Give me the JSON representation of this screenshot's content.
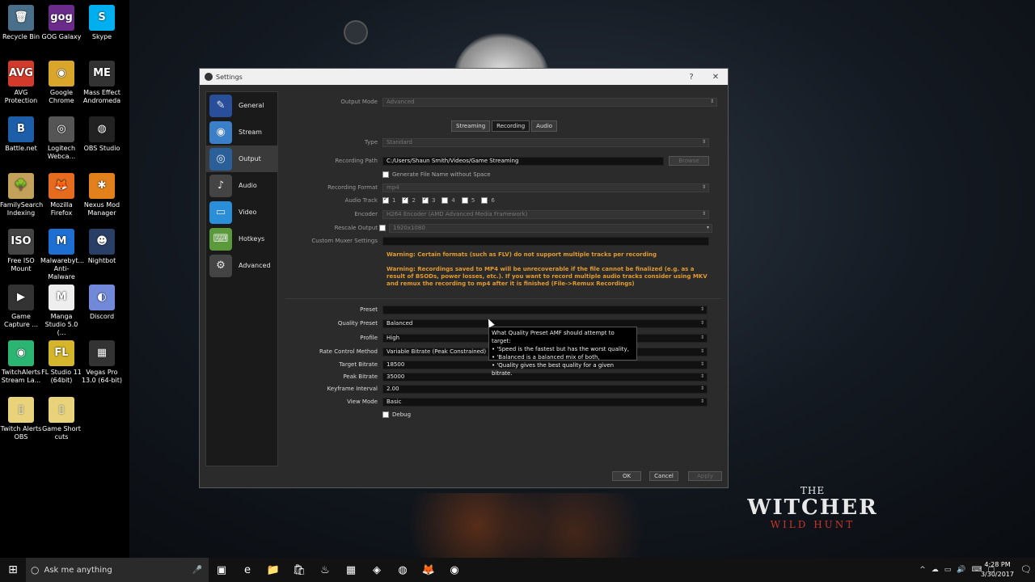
{
  "desktop": {
    "icons": [
      {
        "label": "Recycle Bin",
        "glyph": "🗑",
        "color": "#4a6f8a"
      },
      {
        "label": "GOG Galaxy",
        "glyph": "gog",
        "color": "#6a2b8a"
      },
      {
        "label": "Skype",
        "glyph": "S",
        "color": "#00aff0"
      },
      {
        "label": "AVG Protection",
        "glyph": "AVG",
        "color": "#d23b2b"
      },
      {
        "label": "Google Chrome",
        "glyph": "◉",
        "color": "#d9a52b"
      },
      {
        "label": "Mass Effect Andromeda",
        "glyph": "ME",
        "color": "#333333"
      },
      {
        "label": "Battle.net",
        "glyph": "B",
        "color": "#1c5fa8"
      },
      {
        "label": "Logitech Webca...",
        "glyph": "◎",
        "color": "#555555"
      },
      {
        "label": "OBS Studio",
        "glyph": "◍",
        "color": "#222222"
      },
      {
        "label": "FamilySearch Indexing",
        "glyph": "🌳",
        "color": "#c4a15a"
      },
      {
        "label": "Mozilla Firefox",
        "glyph": "🦊",
        "color": "#e66b1f"
      },
      {
        "label": "Nexus Mod Manager",
        "glyph": "✱",
        "color": "#e2811c"
      },
      {
        "label": "Free ISO Mount",
        "glyph": "ISO",
        "color": "#444444"
      },
      {
        "label": "Malwarebyt... Anti-Malware",
        "glyph": "M",
        "color": "#1d6fd1"
      },
      {
        "label": "Nightbot",
        "glyph": "☻",
        "color": "#2a3f66"
      },
      {
        "label": "Game Capture ...",
        "glyph": "▶",
        "color": "#333333"
      },
      {
        "label": "Manga Studio 5.0 (...",
        "glyph": "M",
        "color": "#eeeeee"
      },
      {
        "label": "Discord",
        "glyph": "◐",
        "color": "#7289da"
      },
      {
        "label": "TwitchAlerts Stream La...",
        "glyph": "◉",
        "color": "#2ab573"
      },
      {
        "label": "FL Studio 11 (64bit)",
        "glyph": "FL",
        "color": "#d4b52b"
      },
      {
        "label": "Vegas Pro 13.0 (64-bit)",
        "glyph": "▦",
        "color": "#333333"
      },
      {
        "label": "Twitch Alerts OBS",
        "glyph": "▯",
        "color": "#e8d37a"
      },
      {
        "label": "Game Short cuts",
        "glyph": "▯",
        "color": "#e8d37a"
      }
    ],
    "witcher": {
      "line1": "THE",
      "line2": "WITCHER",
      "line3": "WILD HUNT"
    }
  },
  "window": {
    "title": "Settings",
    "help": "?",
    "close": "✕",
    "sidebar": [
      {
        "label": "General",
        "glyph": "✎",
        "color": "#2a4f9a"
      },
      {
        "label": "Stream",
        "glyph": "◉",
        "color": "#3a7fc8"
      },
      {
        "label": "Output",
        "glyph": "◎",
        "color": "#2a5f9a"
      },
      {
        "label": "Audio",
        "glyph": "♪",
        "color": "#444444"
      },
      {
        "label": "Video",
        "glyph": "▭",
        "color": "#2a8fd8"
      },
      {
        "label": "Hotkeys",
        "glyph": "⌨",
        "color": "#5a9a3a"
      },
      {
        "label": "Advanced",
        "glyph": "⚙",
        "color": "#444444"
      }
    ],
    "output_mode": {
      "label": "Output Mode",
      "value": "Advanced"
    },
    "tabs": [
      "Streaming",
      "Recording",
      "Audio"
    ],
    "recording": {
      "type": {
        "label": "Type",
        "value": "Standard"
      },
      "path": {
        "label": "Recording Path",
        "value": "C:/Users/Shaun Smith/Videos/Game Streaming",
        "browse": "Browse"
      },
      "no_space": "Generate File Name without Space",
      "format": {
        "label": "Recording Format",
        "value": "mp4"
      },
      "audio_track": {
        "label": "Audio Track",
        "tracks": [
          "1",
          "2",
          "3",
          "4",
          "5",
          "6"
        ]
      },
      "encoder": {
        "label": "Encoder",
        "value": "H264 Encoder (AMD Advanced Media Framework)"
      },
      "rescale": {
        "label": "Rescale Output",
        "value": "1920x1080"
      },
      "muxer": {
        "label": "Custom Muxer Settings"
      },
      "warning1": "Warning: Certain formats (such as FLV) do not support multiple tracks per recording",
      "warning2": "Warning: Recordings saved to MP4 will be unrecoverable if the file cannot be finalized (e.g. as a result of BSODs, power losses, etc.). If you want to record multiple audio tracks consider using MKV and remux the recording to mp4 after it is finished (File->Remux Recordings)",
      "preset": {
        "label": "Preset",
        "value": ""
      },
      "quality_preset": {
        "label": "Quality Preset",
        "value": "Balanced"
      },
      "profile": {
        "label": "Profile",
        "value": "High"
      },
      "rate_control": {
        "label": "Rate Control Method",
        "value": "Variable Bitrate (Peak Constrained) ("
      },
      "target_bitrate": {
        "label": "Target Bitrate",
        "value": "18500"
      },
      "peak_bitrate": {
        "label": "Peak Bitrate",
        "value": "35000"
      },
      "keyframe": {
        "label": "Keyframe Interval",
        "value": "2.00"
      },
      "view_mode": {
        "label": "View Mode",
        "value": "Basic"
      },
      "debug": "Debug"
    },
    "tooltip": {
      "line1": "What Quality Preset AMF should attempt to target:",
      "line2": "• 'Speed is the fastest but has the worst quality,",
      "line3": "• 'Balanced is a balanced mix of both,",
      "line4": "• 'Quality gives the best quality for a given bitrate."
    },
    "buttons": {
      "ok": "OK",
      "cancel": "Cancel",
      "apply": "Apply"
    }
  },
  "taskbar": {
    "search_placeholder": "Ask me anything",
    "apps": [
      "▣",
      "e",
      "📁",
      "🛍",
      "♨",
      "▦",
      "◈",
      "◍",
      "🦊",
      "◉"
    ],
    "tray": [
      "^",
      "☁",
      "▭",
      "🔊",
      "⌨",
      "▢"
    ],
    "time": "4:28 PM",
    "date": "3/30/2017",
    "notif": "🗨"
  }
}
